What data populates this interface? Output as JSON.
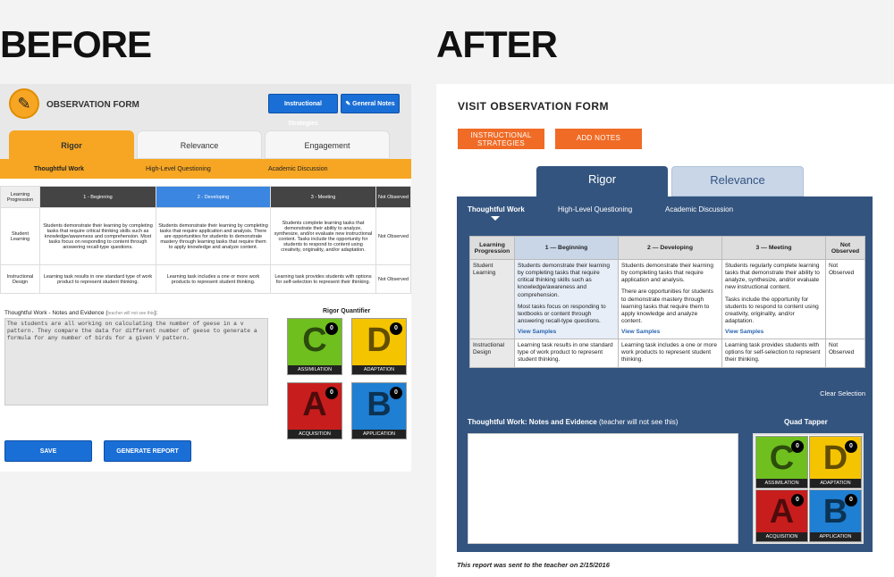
{
  "labels": {
    "before": "BEFORE",
    "after": "AFTER"
  },
  "before": {
    "title": "OBSERVATION FORM",
    "buttons": {
      "instructional": "Instructional Strategies",
      "notes": "General Notes",
      "save": "SAVE",
      "report": "GENERATE REPORT"
    },
    "tabs": [
      "Rigor",
      "Relevance",
      "Engagement"
    ],
    "subtabs": [
      "Thoughtful Work",
      "High-Level Questioning",
      "Academic Discussion"
    ],
    "headers": [
      "Learning Progression",
      "1 - Beginning",
      "2 - Developing",
      "3 - Meeting",
      "Not Observed"
    ],
    "rows": [
      {
        "label": "Student Learning",
        "c1": "Students demonstrate their learning by completing tasks that require critical thinking skills such as knowledge/awareness and comprehension. Most tasks focus on responding to content through answering recall-type questions.",
        "c2": "Students demonstrate their learning by completing tasks that require application and analysis. There are opportunities for students to demonstrate mastery through learning tasks that require them to apply knowledge and analyze content.",
        "c3": "Students complete learning tasks that demonstrate their ability to analyze, synthesize, and/or evaluate new instructional content. Tasks include the opportunity for students to respond to content using creativity, originality, and/or adaptation.",
        "no": "Not Observed"
      },
      {
        "label": "Instructional Design",
        "c1": "Learning task results in one standard type of work product to represent student thinking.",
        "c2": "Learning task includes a one or more work products to represent student thinking.",
        "c3": "Learning task provides students with options for self-selection to represent their thinking.",
        "no": "Not Observed"
      }
    ],
    "notes_label": "Thoughtful Work - Notes and Evidence (",
    "notes_hint": "teacher will not see this",
    "notes_label_end": "):",
    "notes_text": "The students are all working on calculating the number of geese in a v pattern. They compare the data for different number of geese to generate a formula for any number of birds for a given V pattern.",
    "quant_label": "Rigor Quantifier",
    "quad": [
      {
        "letter": "C",
        "cap": "ASSIMILATION",
        "count": "0"
      },
      {
        "letter": "D",
        "cap": "ADAPTATION",
        "count": "0"
      },
      {
        "letter": "A",
        "cap": "ACQUISITION",
        "count": "0"
      },
      {
        "letter": "B",
        "cap": "APPLICATION",
        "count": "0"
      }
    ]
  },
  "after": {
    "title": "VISIT OBSERVATION FORM",
    "buttons": {
      "instructional": "INSTRUCTIONAL STRATEGIES",
      "notes": "ADD NOTES"
    },
    "tabs": [
      "Rigor",
      "Relevance"
    ],
    "subtabs": [
      "Thoughtful Work",
      "High-Level Questioning",
      "Academic Discussion"
    ],
    "headers": [
      "Learning Progression",
      "1 — Beginning",
      "2 — Developing",
      "3 — Meeting",
      "Not Observed"
    ],
    "rows": [
      {
        "label": "Student Learning",
        "c1a": "Students demonstrate their learning by completing tasks that require critical thinking skills such as knowledge/awareness and comprehension.",
        "c1b": "Most tasks focus on responding to textbooks or content through answering recall-type questions.",
        "c2a": "Students demonstrate their learning by completing tasks that require application and analysis.",
        "c2b": "There are opportunities for students to demonstrate mastery through learning tasks that require them to apply knowledge and analyze content.",
        "c3a": "Students regularly complete learning tasks that demonstrate their ability to analyze, synthesize, and/or evaluate new instructional content.",
        "c3b": "Tasks include the opportunity for students to respond to content using creativity, originality, and/or adaptation.",
        "no": "Not Observed"
      },
      {
        "label": "Instructional Design",
        "c1": "Learning task results in one standard type of work product to represent student thinking.",
        "c2": "Learning task includes a one or more work products to represent student thinking.",
        "c3": "Learning task provides students with options for self-selection to represent their thinking.",
        "no": "Not Observed"
      }
    ],
    "view_samples": "View Samples",
    "clear": "Clear Selection",
    "notes_label": "Thoughtful Work: Notes and Evidence",
    "notes_hint": "(teacher will not see this)",
    "quad_label": "Quad Tapper",
    "quad": [
      {
        "letter": "C",
        "cap": "ASSIMILATION",
        "count": "0"
      },
      {
        "letter": "D",
        "cap": "ADAPTATION",
        "count": "0"
      },
      {
        "letter": "A",
        "cap": "ACQUISITION",
        "count": "0"
      },
      {
        "letter": "B",
        "cap": "APPLICATION",
        "count": "0"
      }
    ],
    "footer": "This report was sent to the teacher on 2/15/2016"
  }
}
